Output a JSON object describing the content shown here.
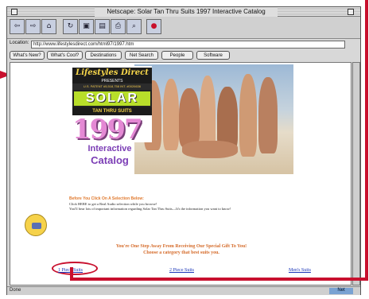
{
  "window": {
    "title": "Netscape: Solar Tan Thru Suits 1997 Interactive Catalog"
  },
  "toolbar": {
    "buttons": [
      {
        "name": "back-button",
        "icon": "back-arrow-icon",
        "glyph": "⇦"
      },
      {
        "name": "forward-button",
        "icon": "forward-arrow-icon",
        "glyph": "⇨"
      },
      {
        "name": "home-button",
        "icon": "home-icon",
        "glyph": "⌂"
      },
      {
        "name": "reload-button",
        "icon": "reload-icon",
        "glyph": "↻"
      },
      {
        "name": "images-button",
        "icon": "images-icon",
        "glyph": "▣"
      },
      {
        "name": "open-button",
        "icon": "open-icon",
        "glyph": "▤"
      },
      {
        "name": "print-button",
        "icon": "print-icon",
        "glyph": "⎙"
      },
      {
        "name": "find-button",
        "icon": "find-icon",
        "glyph": "⌕"
      },
      {
        "name": "stop-button",
        "icon": "stop-icon",
        "glyph": "●"
      }
    ]
  },
  "location": {
    "label": "Location:",
    "url": "http://www.lifestylesdirect.com/html97/1997.htm"
  },
  "directory": {
    "buttons": [
      "What's New?",
      "What's Cool?",
      "Destinations",
      "Net Search",
      "People",
      "Software"
    ]
  },
  "banner": {
    "brand": "Lifestyles Direct",
    "presents": "PRESENTS",
    "patent": "U.S. PATENT #5,518,758 INT. #0026636",
    "logo": "SOLAR",
    "product": "TAN THRU SUITS",
    "year": "1997",
    "line1": "Interactive",
    "line2": "Catalog"
  },
  "body": {
    "info_heading": "Before You Click On A Selection Below:",
    "info_line1": "Click HERE to get a Real Audio selection while you browse!",
    "info_line2": "You'll hear lots of important information regarding Solar Tan Thru Suits—It's the information you want to know!",
    "promo_line1": "You're One Step Away From Receiving Our Special Gift To You!",
    "promo_line2": "Choose a category that best suits you."
  },
  "categories": [
    "1 Piece Suits",
    "2 Piece Suits",
    "Men's Suits"
  ],
  "status": {
    "left": "Done",
    "right": "Net"
  },
  "colors": {
    "annotation": "#c8102e",
    "link": "#1a35b8",
    "promo": "#d56b2a",
    "logo_green": "#b8de2a"
  }
}
